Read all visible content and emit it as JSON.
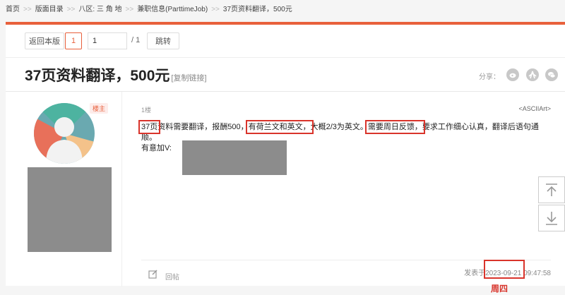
{
  "breadcrumb": {
    "items": [
      "首页",
      "版面目录",
      "八区: 三 角 地",
      "兼职信息(ParttimeJob)",
      "37页资料翻译，500元"
    ],
    "separator": ">>"
  },
  "nav": {
    "back_label": "返回本版",
    "current_page": "1",
    "page_input_value": "1",
    "total_pages": "/ 1",
    "jump_label": "跳转"
  },
  "post_header": {
    "title": "37页资料翻译，500元",
    "copy_link": "[复制链接]",
    "share_label": "分享："
  },
  "post": {
    "op_badge": "楼主",
    "floor": "1楼",
    "username": "<ASCIIArt>",
    "segments": {
      "pages": "37页",
      "text1": "资料需要翻译，报酬500，",
      "langs": "有荷兰文和英文，",
      "text2": "大概2/3为英文。",
      "daily": "需要周日反馈，",
      "text3": "要求工作细心认真，翻译后语句通",
      "text4": "顺。",
      "contact": "有意加V:"
    },
    "reply_label": "回帖",
    "posted_prefix": "发表于",
    "posted_date": "2023-09-21",
    "posted_time": "09:47:58"
  },
  "annotation": {
    "weekday": "周四"
  },
  "colors": {
    "accent": "#e8603c",
    "highlight": "#d9342b"
  },
  "icons": {
    "share": [
      "weibo-icon",
      "renren-icon",
      "wechat-icon"
    ],
    "scroll": [
      "scroll-to-top-icon",
      "scroll-to-bottom-icon"
    ],
    "reply": "reply-edit-icon"
  }
}
